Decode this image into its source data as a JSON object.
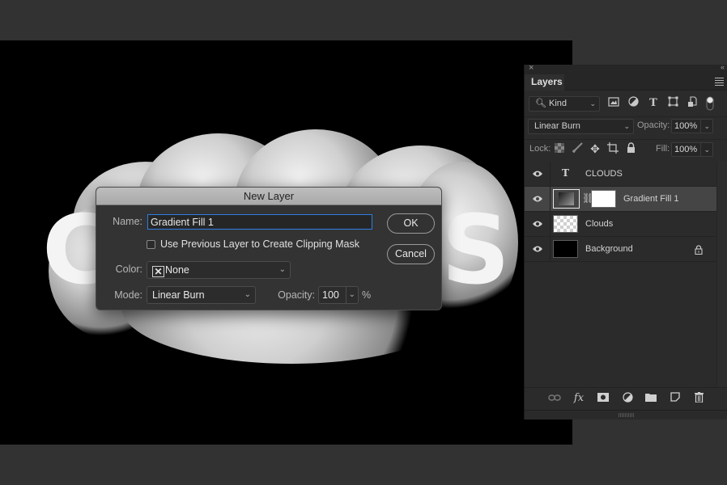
{
  "canvas": {
    "text_letters_visible": [
      "C",
      "S"
    ],
    "background_color": "#000000"
  },
  "dialog": {
    "title": "New Layer",
    "name_label": "Name:",
    "name_value": "Gradient Fill 1",
    "clipping_checkbox_label": "Use Previous Layer to Create Clipping Mask",
    "clipping_checked": false,
    "color_label": "Color:",
    "color_value": "None",
    "mode_label": "Mode:",
    "mode_value": "Linear Burn",
    "opacity_label": "Opacity:",
    "opacity_value": "100",
    "opacity_unit": "%",
    "ok_label": "OK",
    "cancel_label": "Cancel",
    "focus_color": "#2f7de1"
  },
  "layers_panel": {
    "tab_label": "Layers",
    "filter": {
      "kind_value": "Kind",
      "filter_icons": [
        "image-filter-icon",
        "adjustment-filter-icon",
        "type-filter-icon",
        "shape-filter-icon",
        "smart-object-filter-icon",
        "filter-toggle-icon"
      ]
    },
    "blend_mode": "Linear Burn",
    "opacity_label": "Opacity:",
    "opacity_value": "100%",
    "lock_label": "Lock:",
    "fill_label": "Fill:",
    "fill_value": "100%",
    "layers": [
      {
        "name": "CLOUDS",
        "type": "text",
        "visible": true,
        "selected": false,
        "locked": false
      },
      {
        "name": "Gradient Fill 1",
        "type": "fill",
        "visible": true,
        "selected": true,
        "locked": false
      },
      {
        "name": "Clouds",
        "type": "pixel",
        "visible": true,
        "selected": false,
        "locked": false
      },
      {
        "name": "Background",
        "type": "background",
        "visible": true,
        "selected": false,
        "locked": true
      }
    ],
    "footer_icons": [
      "link-layers-icon",
      "fx-icon",
      "add-mask-icon",
      "new-adjustment-icon",
      "new-group-icon",
      "new-layer-icon",
      "delete-layer-icon"
    ]
  }
}
